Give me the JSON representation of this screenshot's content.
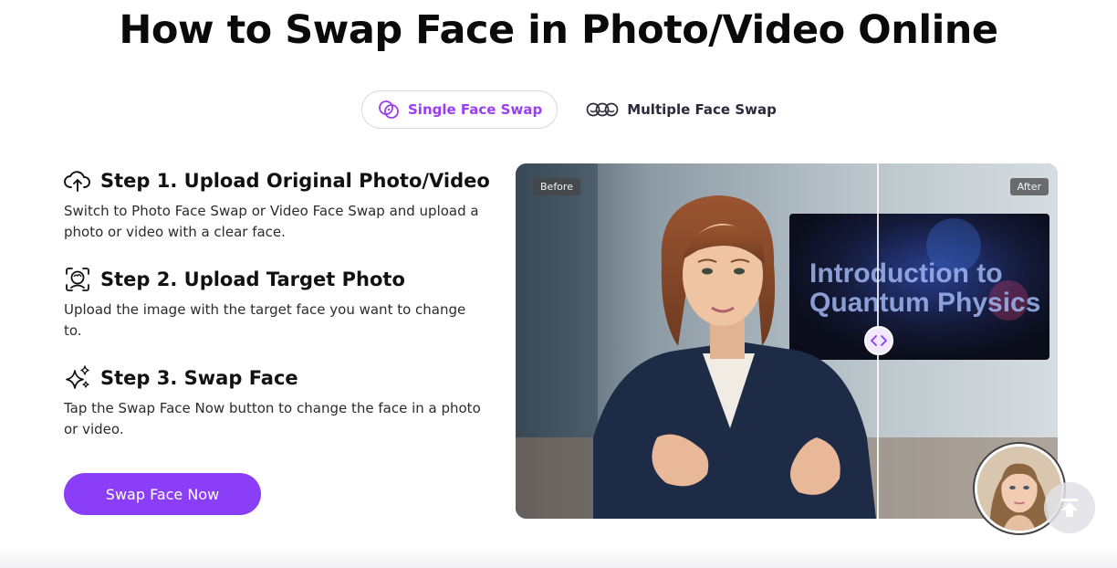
{
  "page": {
    "title": "How to Swap Face in Photo/Video Online"
  },
  "tabs": [
    {
      "label": "Single Face Swap",
      "active": true,
      "icon": "single-face-icon"
    },
    {
      "label": "Multiple Face Swap",
      "active": false,
      "icon": "multiple-face-icon"
    }
  ],
  "steps": [
    {
      "title": "Step 1. Upload Original Photo/Video",
      "description": "Switch to Photo Face Swap or Video Face Swap and upload a photo or video with a clear face.",
      "icon": "cloud-upload-icon"
    },
    {
      "title": "Step 2. Upload Target Photo",
      "description": "Upload the image with the target face you want to change to.",
      "icon": "face-scan-icon"
    },
    {
      "title": "Step 3. Swap Face",
      "description": "Tap the Swap Face Now button to change the face in a photo or video.",
      "icon": "sparkles-icon"
    }
  ],
  "cta": {
    "label": "Swap Face Now"
  },
  "comparison": {
    "before_label": "Before",
    "after_label": "After",
    "screen_text_line1": "Introduction to",
    "screen_text_line2": "Quantum Physics"
  },
  "colors": {
    "accent": "#8b3ef8",
    "tab_active_text": "#9b3df0",
    "handle_bg": "#f2e9ff"
  }
}
